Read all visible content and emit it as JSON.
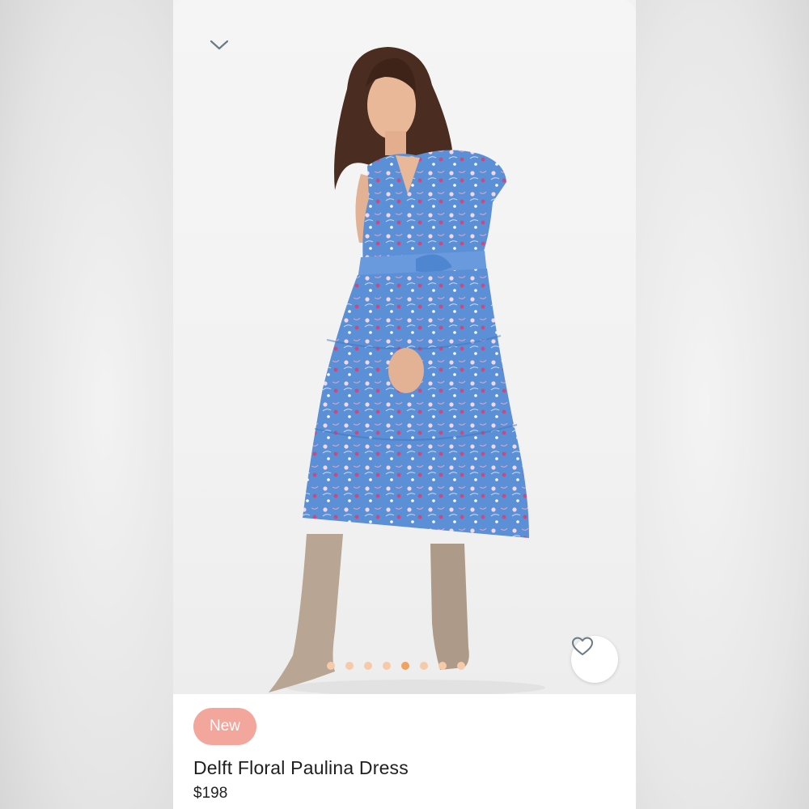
{
  "product": {
    "badge": "New",
    "title": "Delft Floral Paulina Dress",
    "price": "$198"
  },
  "gallery": {
    "image_count": 8,
    "active_index": 4
  },
  "icons": {
    "collapse": "chevron-down-icon",
    "favorite": "heart-outline-icon"
  },
  "colors": {
    "badge_bg": "#f3a69c",
    "dot_inactive": "#f6c9a8",
    "dot_active": "#f0a25e",
    "dress_blue": "#5b8fd6",
    "icon_gray": "#6d7a86"
  }
}
